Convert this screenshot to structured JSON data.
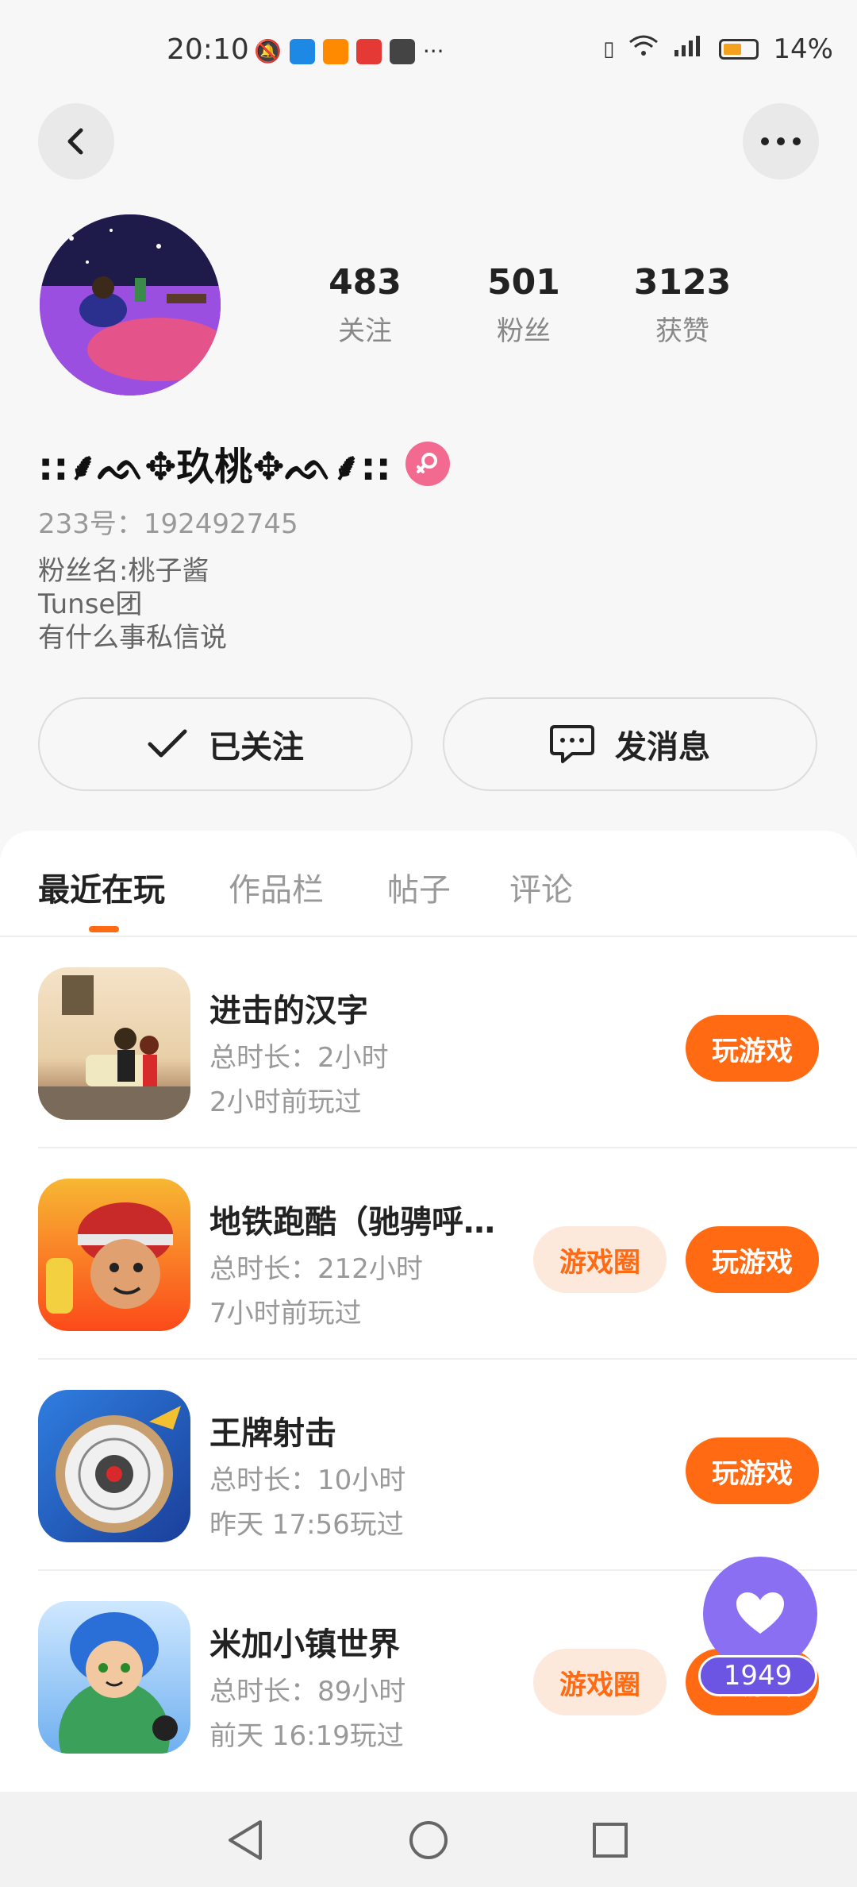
{
  "status_bar": {
    "time": "20:10",
    "battery": "14%",
    "battery_level": 0.14,
    "notification_icons": [
      "mute-icon",
      "weather-app-icon",
      "video-app-icon",
      "huawei-app-icon",
      "mail-app-icon",
      "more-icon"
    ],
    "system_icons": [
      "vibrate-icon",
      "wifi-icon",
      "4g-signal-icon",
      "battery-icon"
    ]
  },
  "header": {
    "back_icon": "chevron-left-icon",
    "more_icon": "more-dots-icon"
  },
  "profile": {
    "nickname": "::⸙ᨒ✥玖桃✥ᨒ⸙::",
    "gender": "female",
    "uid": "233号：192492745",
    "stats": [
      {
        "num": "483",
        "label": "关注"
      },
      {
        "num": "501",
        "label": "粉丝"
      },
      {
        "num": "3123",
        "label": "获赞"
      }
    ],
    "bio": [
      "粉丝名:桃子酱",
      "Tunse团",
      "有什么事私信说"
    ],
    "follow_label": "已关注",
    "message_label": "发消息"
  },
  "tabs": [
    "最近在玩",
    "作品栏",
    "帖子",
    "评论"
  ],
  "games": [
    {
      "name": "进击的汉字",
      "duration": "总时长：2小时",
      "last_played": "2小时前玩过",
      "has_circle": false,
      "play_label": "玩游戏"
    },
    {
      "name": "地铁跑酷（驰骋呼…",
      "duration": "总时长：212小时",
      "last_played": "7小时前玩过",
      "has_circle": true,
      "circle_label": "游戏圈",
      "play_label": "玩游戏"
    },
    {
      "name": "王牌射击",
      "duration": "总时长：10小时",
      "last_played": "昨天 17:56玩过",
      "has_circle": false,
      "play_label": "玩游戏"
    },
    {
      "name": "米加小镇世界",
      "duration": "总时长：89小时",
      "last_played": "前天 16:19玩过",
      "has_circle": true,
      "circle_label": "游戏圈",
      "play_label": "玩游戏"
    }
  ],
  "like_fab": {
    "count": "1949",
    "icon": "heart-icon"
  },
  "colors": {
    "accent": "#ff6a13",
    "fab": "#8b6ff2",
    "gender": "#f26a8f"
  }
}
